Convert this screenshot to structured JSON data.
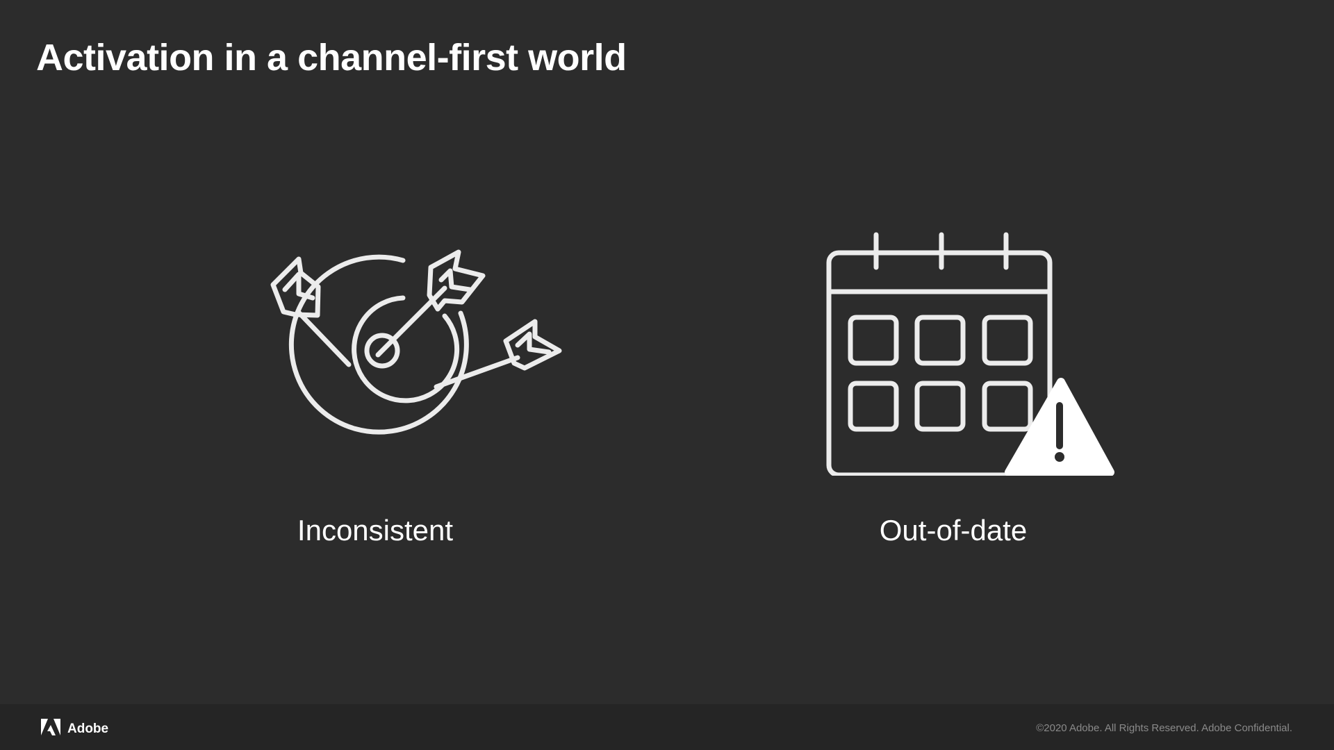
{
  "slide": {
    "title": "Activation in a channel-first world"
  },
  "items": [
    {
      "label": "Inconsistent",
      "icon": "target-with-arrows-icon"
    },
    {
      "label": "Out-of-date",
      "icon": "calendar-warning-icon"
    }
  ],
  "footer": {
    "brand": "Adobe",
    "copyright": "©2020 Adobe. All Rights Reserved. Adobe Confidential.",
    "logo_icon": "adobe-logo-icon"
  },
  "colors": {
    "background": "#2c2c2c",
    "footer_background": "#252525",
    "text": "#ffffff",
    "icon_stroke": "#ececec",
    "muted_text": "#8a8a8a"
  }
}
